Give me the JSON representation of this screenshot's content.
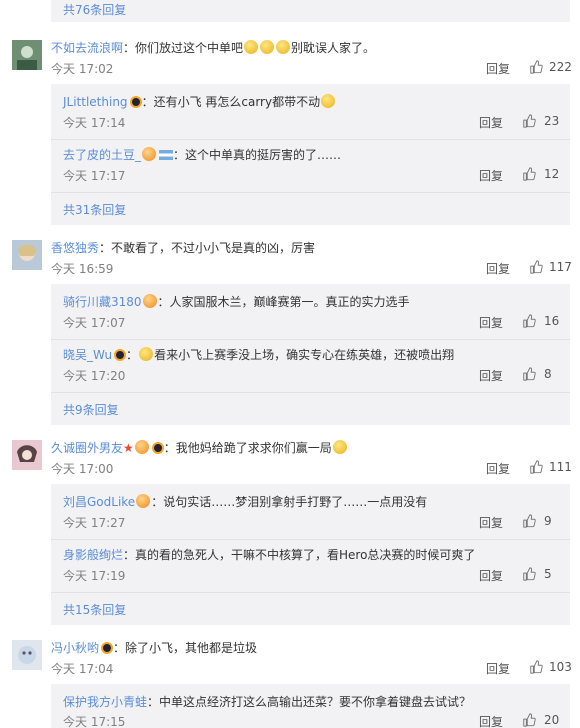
{
  "top_more": "共76条回复",
  "reply_label": "回复",
  "comments": [
    {
      "user": "不如去流浪啊",
      "text_a": "：你们放过这个中单吧",
      "text_b": "别耽误人家了。",
      "time": "今天 17:02",
      "likes": "222",
      "replies": [
        {
          "user": "JLittlething",
          "text": "：还有小飞 再怎么carry都带不动",
          "time": "今天 17:14",
          "likes": "23"
        },
        {
          "user": "去了皮的土豆_",
          "text": "：这个中单真的挺厉害的了……",
          "time": "今天 17:17",
          "likes": "12"
        }
      ],
      "more": "共31条回复"
    },
    {
      "user": "香悠独秀",
      "text_a": "：不敢看了，不过小小飞是真的凶，厉害",
      "time": "今天 16:59",
      "likes": "117",
      "replies": [
        {
          "user": "骑行川藏3180",
          "text": "：人家国服木兰，巅峰赛第一。真正的实力选手",
          "time": "今天 17:07",
          "likes": "16"
        },
        {
          "user": "晓吴_Wu",
          "text": "看来小飞上赛季没上场，确实专心在练英雄，还被喷出翔",
          "time": "今天 17:20",
          "likes": "8"
        }
      ],
      "more": "共9条回复"
    },
    {
      "user": "久诚圈外男友",
      "text_a": "：我他妈给跪了求求你们赢一局",
      "time": "今天 17:00",
      "likes": "111",
      "replies": [
        {
          "user": "刘昌GodLike",
          "text": "：说句实话……梦泪别拿射手打野了……一点用没有",
          "time": "今天 17:27",
          "likes": "9"
        },
        {
          "user": "身影般绚烂",
          "text": "：真的看的急死人，干嘛不中核算了，看Hero总决赛的时候可爽了",
          "time": "今天 17:19",
          "likes": "5"
        }
      ],
      "more": "共15条回复"
    },
    {
      "user": "冯小秋哟",
      "text_a": "：除了小飞，其他都是垃圾",
      "time": "今天 17:04",
      "likes": "103",
      "replies": [
        {
          "user": "保护我方小青蛙",
          "text": "：中单这点经济打这么高输出还菜？要不你拿着键盘去试试？",
          "time": "今天 17:15",
          "likes": "20"
        }
      ]
    }
  ]
}
